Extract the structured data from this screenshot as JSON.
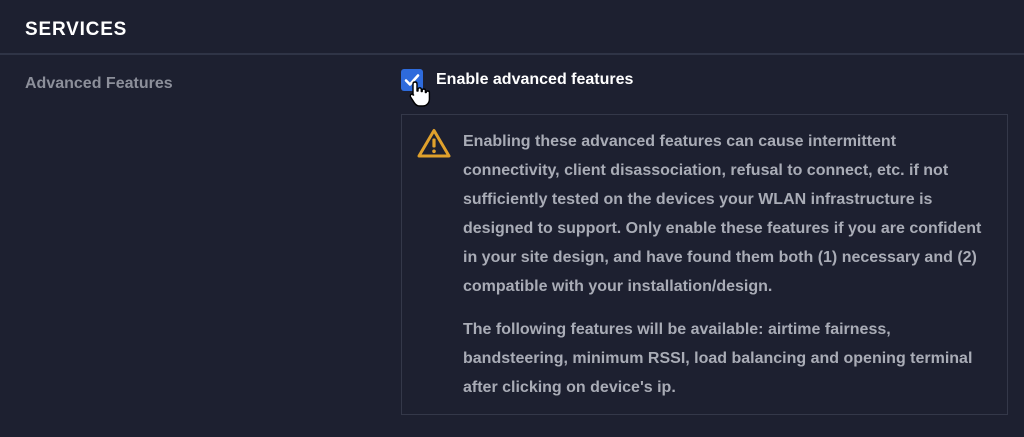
{
  "section": {
    "title": "SERVICES"
  },
  "advanced": {
    "label": "Advanced Features",
    "checkbox_label": "Enable advanced features",
    "checked": true,
    "warning_icon": "warning-triangle-icon",
    "warning_text": "Enabling these advanced features can cause intermittent connectivity, client disassociation, refusal to connect, etc. if not sufficiently tested on the devices your WLAN infrastructure is designed to support. Only enable these features if you are confident in your site design, and have found them both (1) necessary and (2) compatible with your installation/design.",
    "features_text": "The following features will be available: airtime fairness, bandsteering, minimum RSSI, load balancing and opening terminal after clicking on device's ip."
  },
  "colors": {
    "background": "#1d2030",
    "checkbox_accent": "#2e6bdc",
    "warning_icon": "#e0a12c",
    "divider": "#2f3446"
  }
}
